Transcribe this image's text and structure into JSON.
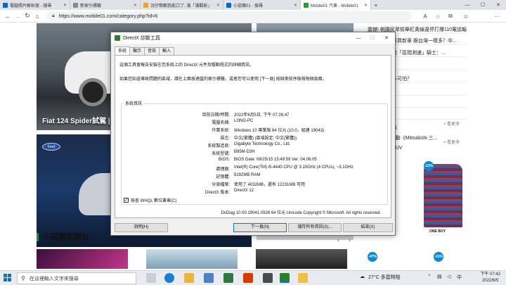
{
  "browser": {
    "tabs": [
      {
        "label": "電腦照片解析度 - 搜尋",
        "color": "#0a66c2",
        "active": false
      },
      {
        "label": "新索引標籤",
        "color": "#8a8a8a",
        "active": false
      },
      {
        "label": "況仔簡都我能口了; 滿「滿觀影」",
        "color": "#e8a23a",
        "active": false
      },
      {
        "label": "小惡魔01 - 搜尋",
        "color": "#0a66c2",
        "active": false
      },
      {
        "label": "Mobile01 汽車 - Mobile01",
        "color": "#2b9a3e",
        "active": true
      }
    ],
    "tab_close": "✕",
    "new_tab": "+",
    "window_controls": {
      "minimize": "—",
      "maximize": "☐",
      "close": "✕"
    },
    "url": "https://www.mobile01.com/category.php?id=6",
    "toolbar_labels": {
      "read_aloud": "A",
      "favorites": "☆",
      "collections": "⧉",
      "profile": "☺",
      "more": "···"
    }
  },
  "page": {
    "hero1_title": "Fiat 124 Spider試駕 |",
    "section_title": "小惡魔新聞台",
    "pager_prev": "‹",
    "pager_next": "›",
    "right_links": [
      "震撼! 桃園民眾檢舉紅黃線違停打爆110電話報...",
      "車款？中古車買新車 跟台灣一樣多？中...",
      "出什麼新機設「區間測速」騎士：...",
      "解方！？",
      "到底有沒有多可怕？",
      "嗎？",
      "路！",
      "調？",
      "包裝及安賽車",
      "的親子DIY活動《Mitsubishi 三...",
      "經的偽裝車SUV"
    ],
    "right_more_1": "× 看更多",
    "right_more_2": "× 看更多",
    "sale_badges": [
      "-21%",
      "-47%",
      "-31%"
    ],
    "brand": "ONE BOY"
  },
  "dialog": {
    "title": "DirectX 診斷工具",
    "tabs": [
      "系統",
      "顯示",
      "音效",
      "輸入"
    ],
    "intro_1": "這個工具會報告安裝在您系統上的 DirectX 元件及驅動程式的詳細資訊。",
    "intro_2": "如果您知道導致問題的區域，請在上面按適當的索引標籤，或者您可以使用 [下一頁] 按鈕來依序檢視每個頁面。",
    "group_label": "系統資訊",
    "system_info": [
      {
        "key": "目前日期/時間:",
        "value": "2022年6月5日, 下午 07:26:47"
      },
      {
        "key": "電腦名稱:",
        "value": "LONG-PC"
      },
      {
        "key": "作業系統:",
        "value": "Windows 10 專業版 64 位元 (10.0，組建 19043)"
      },
      {
        "key": "語言:",
        "value": "中文(繁體) (區域設定: 中文(繁體))"
      },
      {
        "key": "系統製造商:",
        "value": "Gigabyte Technology Co., Ltd."
      },
      {
        "key": "系統型號:",
        "value": "B85M-D3H"
      },
      {
        "key": "BIOS:",
        "value": "BIOS Date: 08/25/15 15:49:59 Ver: 04.06.05"
      },
      {
        "key": "處理器:",
        "value": "Intel(R) Core(TM) i5-4440 CPU @ 3.10GHz (4 CPUs), ~3.1GHz"
      },
      {
        "key": "記憶體:",
        "value": "8192MB RAM"
      },
      {
        "key": "分頁檔案:",
        "value": "使用了 4032MB，還有 12231MB 可用"
      },
      {
        "key": "DirectX 版本:",
        "value": "DirectX 12"
      }
    ],
    "whql_label": "檢查 WHQL 數位簽章(C)",
    "whql_checked": "✓",
    "copyright": "DxDiag 10.00.19041.0928 64 位元 Unicode  Copyright © Microsoft. All rights reserved.",
    "buttons": {
      "help": "說明(H)",
      "next": "下一頁(N)",
      "save": "儲存所有資訊(S)...",
      "exit": "結束(X)"
    },
    "controls": {
      "minimize": "—",
      "maximize": "☐",
      "close": "✕"
    }
  },
  "taskbar": {
    "search_placeholder": "在這裡輸入文字來搜尋",
    "temperature": "27°C 多雲時陰",
    "time": "下午 07:42",
    "date": "2022/6/5"
  }
}
